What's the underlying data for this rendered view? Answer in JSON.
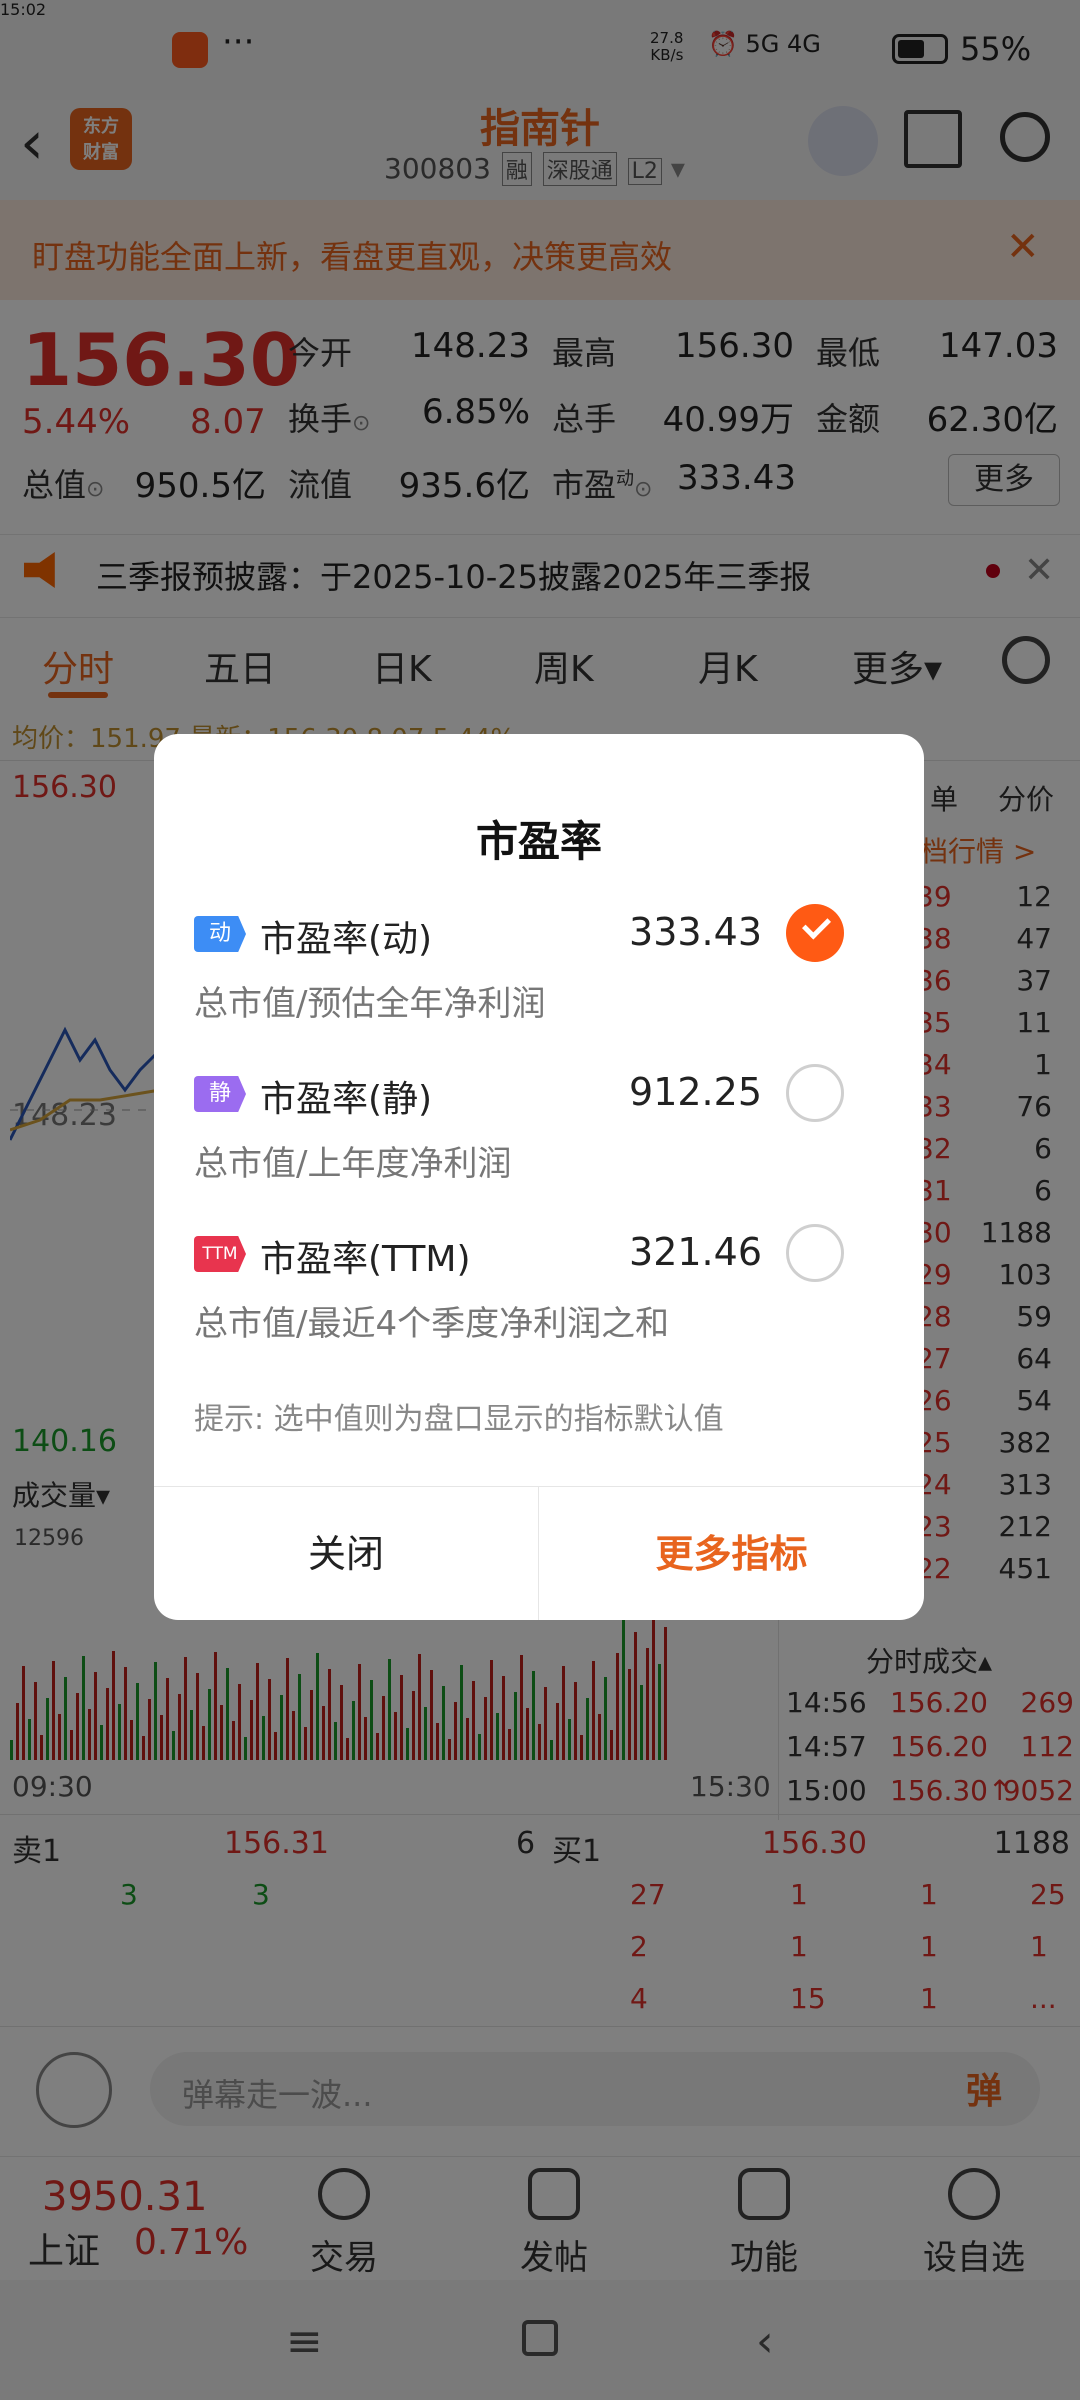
{
  "status": {
    "time": "15:02",
    "dots": "···",
    "speed_top": "27.8",
    "speed_bot": "KB/s",
    "signal": "⏰ 5G 4G",
    "battery": "55%"
  },
  "header": {
    "stock_name": "指南针",
    "code": "300803",
    "tag1": "融",
    "tag2": "深股通",
    "tag3": "L2",
    "logo_top": "东方",
    "logo_bot": "财富"
  },
  "banner": {
    "text": "盯盘功能全面上新，看盘更直观，决策更高效"
  },
  "quote": {
    "price": "156.30",
    "pct": "5.44%",
    "chg": "8.07",
    "open_label": "今开",
    "open": "148.23",
    "high_label": "最高",
    "high": "156.30",
    "low_label": "最低",
    "low": "147.03",
    "turnover_label": "换手",
    "turnover": "6.85%",
    "volume_label": "总手",
    "volume": "40.99万",
    "amount_label": "金额",
    "amount": "62.30亿",
    "mktcap_label": "总值",
    "mktcap": "950.5亿",
    "float_label": "流值",
    "float": "935.6亿",
    "pe_label": "市盈",
    "pe_sup": "动",
    "pe": "333.43",
    "more": "更多"
  },
  "notice": {
    "text": "三季报预披露：于2025-10-25披露2025年三季报"
  },
  "tabs": [
    "分时",
    "五日",
    "日K",
    "周K",
    "月K",
    "更多▾"
  ],
  "chart": {
    "avg_line": "均价：151.97 最新：156.30 8.07 5.44%",
    "top": "156.30",
    "mid": "148.23",
    "bottom": "140.16",
    "vol_label": "成交量▾",
    "vol_max": "12596",
    "time_start": "09:30",
    "time_end": "15:30"
  },
  "right_panel": {
    "tab1": "单",
    "tab2": "分价",
    "link": "档行情 >",
    "rows": [
      [
        "39",
        "12"
      ],
      [
        "38",
        "47"
      ],
      [
        "36",
        "37"
      ],
      [
        "35",
        "11"
      ],
      [
        "34",
        "1"
      ],
      [
        "33",
        "76"
      ],
      [
        "32",
        "6"
      ],
      [
        "31",
        "6"
      ],
      [
        "30",
        "1188"
      ],
      [
        "29",
        "103"
      ],
      [
        "28",
        "59"
      ],
      [
        "27",
        "64"
      ],
      [
        "26",
        "54"
      ],
      [
        "25",
        "382"
      ],
      [
        "24",
        "313"
      ],
      [
        "23",
        "212"
      ],
      [
        "22",
        "451"
      ]
    ],
    "ticks_title": "分时成交▴",
    "ticks": [
      [
        "14:56",
        "156.20",
        "269"
      ],
      [
        "14:57",
        "156.20",
        "112"
      ],
      [
        "15:00",
        "156.30↑",
        "9052"
      ]
    ]
  },
  "orderbook": {
    "sell_label": "卖1",
    "sell_price": "156.31",
    "sell_vol": "6",
    "buy_label": "买1",
    "buy_price": "156.30",
    "buy_vol": "1188",
    "sell_detail": [
      "3",
      "3"
    ],
    "buy_detail": [
      [
        "27",
        "1",
        "1",
        "25"
      ],
      [
        "2",
        "1",
        "1",
        "1"
      ],
      [
        "4",
        "15",
        "1",
        "..."
      ]
    ]
  },
  "comment": {
    "placeholder": "弹幕走一波...",
    "danmu": "弹"
  },
  "bottom_nav": {
    "index_val": "3950.31",
    "index_name": "上证",
    "index_pct": "0.71%",
    "items": [
      "交易",
      "发帖",
      "功能",
      "设自选"
    ]
  },
  "dialog": {
    "title": "市盈率",
    "options": [
      {
        "badge": "动",
        "name": "市盈率(动)",
        "value": "333.43",
        "desc": "总市值/预估全年净利润",
        "badge_color": "#3d8df5",
        "selected": true
      },
      {
        "badge": "静",
        "name": "市盈率(静)",
        "value": "912.25",
        "desc": "总市值/上年度净利润",
        "badge_color": "#9b6cf0",
        "selected": false
      },
      {
        "badge": "TTM",
        "name": "市盈率(TTM)",
        "value": "321.46",
        "desc": "总市值/最近4个季度净利润之和",
        "badge_color": "#e8344e",
        "selected": false
      }
    ],
    "tip": "提示: 选中值则为盘口显示的指标默认值",
    "close": "关闭",
    "more": "更多指标"
  }
}
